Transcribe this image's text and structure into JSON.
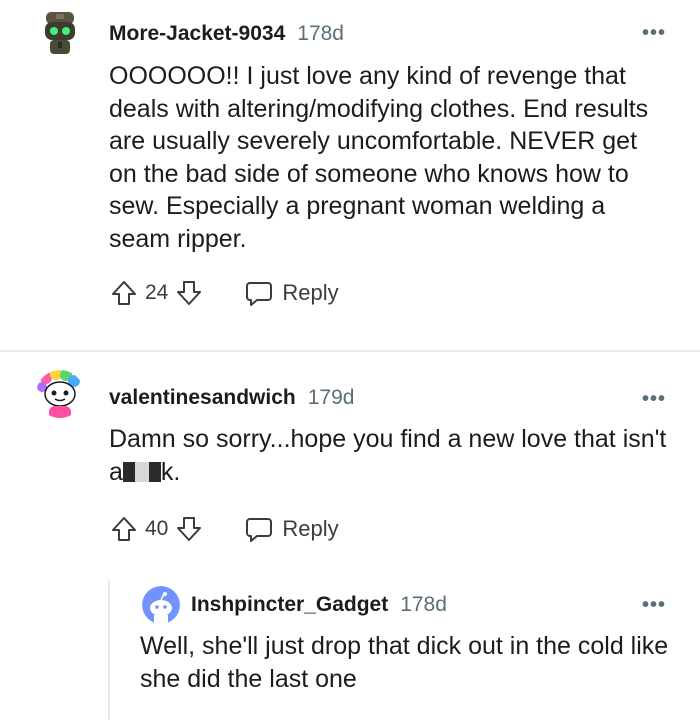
{
  "comments": [
    {
      "author": "More-Jacket-9034",
      "age": "178d",
      "more_label": "•••",
      "body": "OOOOOO!! I just love any kind of revenge that deals with altering/modifying clothes. End results are usually severely uncomfortable. NEVER get on the bad side of someone who knows how to sew. Especially a pregnant woman welding a seam ripper.",
      "votes": "24",
      "reply_label": "Reply"
    },
    {
      "author": "valentinesandwich",
      "age": "179d",
      "more_label": "•••",
      "body_before": "Damn so sorry...hope you find a new love that isn't a",
      "body_after": "k.",
      "votes": "40",
      "reply_label": "Reply"
    },
    {
      "author": "Inshpincter_Gadget",
      "age": "178d",
      "more_label": "•••",
      "body": "Well, she'll just drop that dick out in the cold like she did the last one"
    }
  ],
  "colors": {
    "text": "#1c1c1c",
    "meta": "#576f76",
    "divider": "#e5ebee",
    "avatar_blue": "#7193ff"
  }
}
